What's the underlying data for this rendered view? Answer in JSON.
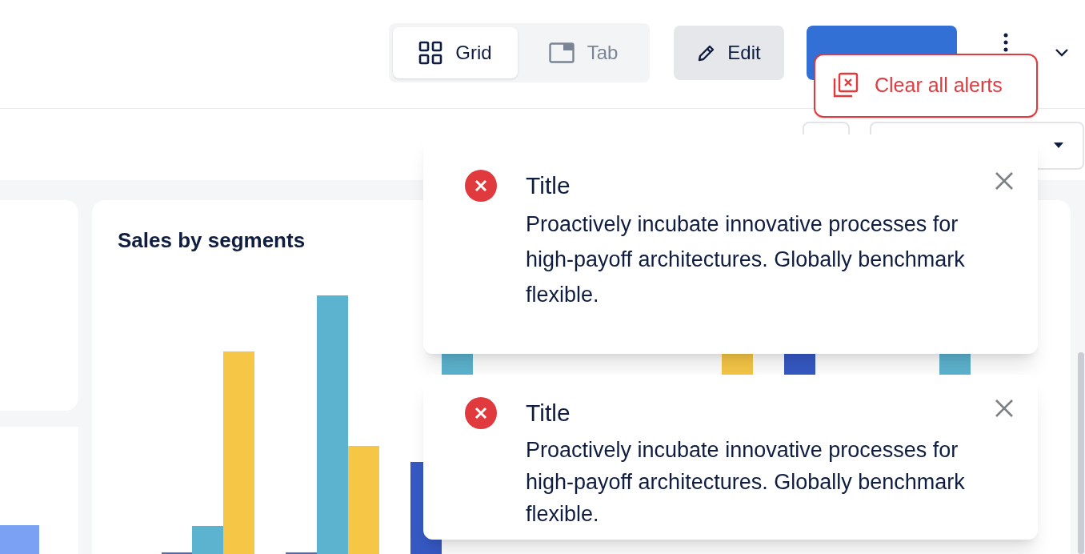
{
  "view_toggle": [
    {
      "label": "Grid",
      "selected": true
    },
    {
      "label": "Tab",
      "selected": false
    }
  ],
  "edit_button": {
    "label": "Edit"
  },
  "alerts_menu": {
    "items": [
      {
        "label": "Clear all alerts"
      }
    ]
  },
  "chart_card": {
    "title": "Sales by segments"
  },
  "alerts": [
    {
      "kind": "error",
      "title": "Title",
      "message": "Proactively incubate innovative processes for high-payoff architectures. Globally benchmark flexible."
    },
    {
      "kind": "error",
      "title": "Title",
      "message": "Proactively incubate innovative processes for high-payoff architectures. Globally benchmark flexible."
    }
  ]
}
